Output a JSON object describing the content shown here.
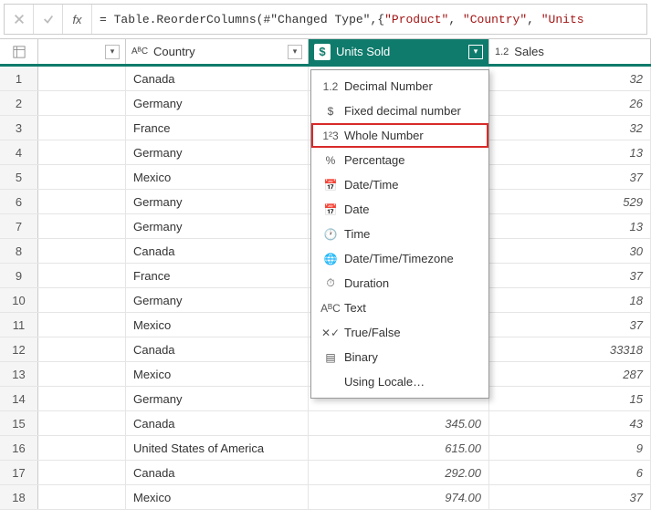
{
  "formula": {
    "prefix": "= ",
    "func": "Table.ReorderColumns",
    "arg_ref": "#\"Changed Type\"",
    "list_open": ",{",
    "s1": "\"Product\"",
    "s2": "\"Country\"",
    "s3": "\"Units"
  },
  "columns": {
    "col2": {
      "type_icon": "AᴮC",
      "name": "Country"
    },
    "col3": {
      "type_icon": "$",
      "name": "Units Sold"
    },
    "col4": {
      "type_icon": "1.2",
      "name": "Sales"
    }
  },
  "type_menu": [
    {
      "icon": "1.2",
      "label": "Decimal Number"
    },
    {
      "icon": "$",
      "label": "Fixed decimal number"
    },
    {
      "icon": "1²3",
      "label": "Whole Number",
      "highlight": true
    },
    {
      "icon": "%",
      "label": "Percentage"
    },
    {
      "icon": "📅",
      "label": "Date/Time"
    },
    {
      "icon": "📅",
      "label": "Date"
    },
    {
      "icon": "🕐",
      "label": "Time"
    },
    {
      "icon": "🌐",
      "label": "Date/Time/Timezone"
    },
    {
      "icon": "⏱",
      "label": "Duration"
    },
    {
      "icon": "AᴮC",
      "label": "Text"
    },
    {
      "icon": "✕✓",
      "label": "True/False"
    },
    {
      "icon": "▤",
      "label": "Binary"
    },
    {
      "icon": "",
      "label": "Using Locale…"
    }
  ],
  "rows": [
    {
      "n": "1",
      "country": "Canada",
      "units": "",
      "sales": "32"
    },
    {
      "n": "2",
      "country": "Germany",
      "units": "",
      "sales": "26"
    },
    {
      "n": "3",
      "country": "France",
      "units": "",
      "sales": "32"
    },
    {
      "n": "4",
      "country": "Germany",
      "units": "",
      "sales": "13"
    },
    {
      "n": "5",
      "country": "Mexico",
      "units": "",
      "sales": "37"
    },
    {
      "n": "6",
      "country": "Germany",
      "units": "",
      "sales": "529"
    },
    {
      "n": "7",
      "country": "Germany",
      "units": "",
      "sales": "13"
    },
    {
      "n": "8",
      "country": "Canada",
      "units": "",
      "sales": "30"
    },
    {
      "n": "9",
      "country": "France",
      "units": "",
      "sales": "37"
    },
    {
      "n": "10",
      "country": "Germany",
      "units": "",
      "sales": "18"
    },
    {
      "n": "11",
      "country": "Mexico",
      "units": "",
      "sales": "37"
    },
    {
      "n": "12",
      "country": "Canada",
      "units": "",
      "sales": "33318"
    },
    {
      "n": "13",
      "country": "Mexico",
      "units": "",
      "sales": "287"
    },
    {
      "n": "14",
      "country": "Germany",
      "units": "",
      "sales": "15"
    },
    {
      "n": "15",
      "country": "Canada",
      "units": "345.00",
      "sales": "43"
    },
    {
      "n": "16",
      "country": "United States of America",
      "units": "615.00",
      "sales": "9"
    },
    {
      "n": "17",
      "country": "Canada",
      "units": "292.00",
      "sales": "6"
    },
    {
      "n": "18",
      "country": "Mexico",
      "units": "974.00",
      "sales": "37"
    }
  ]
}
